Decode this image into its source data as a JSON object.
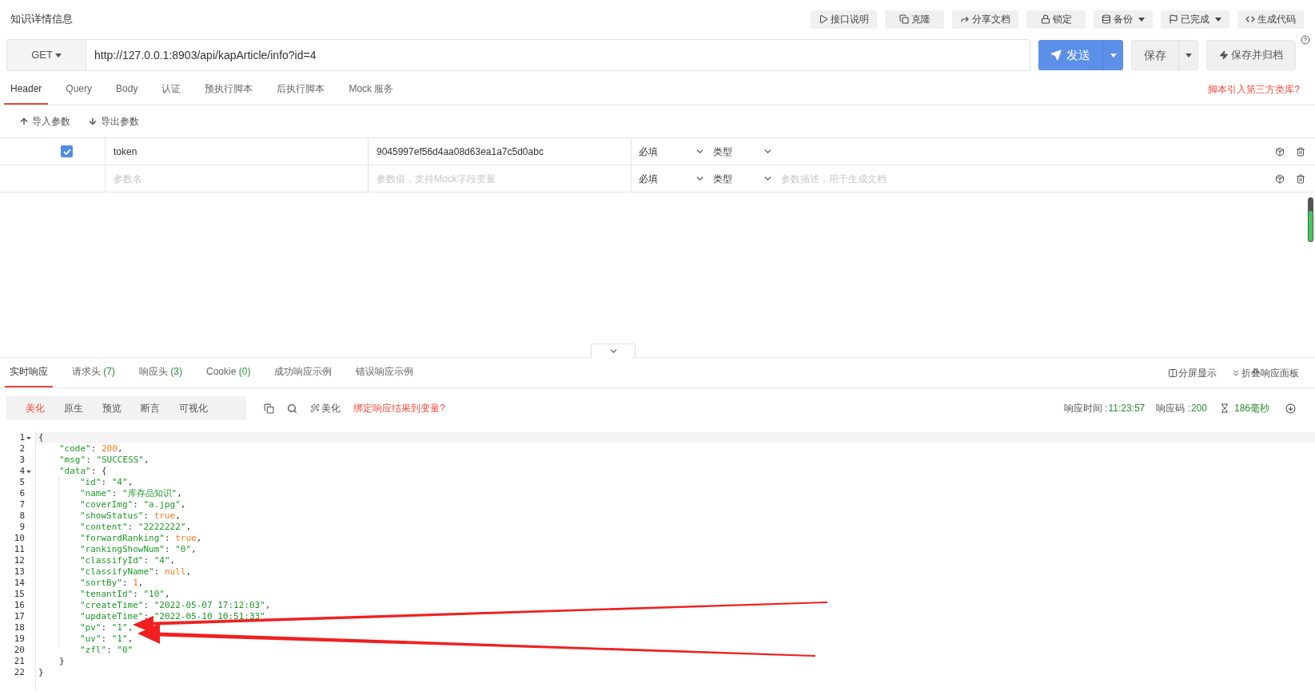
{
  "page_title": "知识详情信息",
  "toolbar": [
    {
      "label": "接口说明",
      "caret": false
    },
    {
      "label": "克隆",
      "caret": false
    },
    {
      "label": "分享文档",
      "caret": false
    },
    {
      "label": "锁定",
      "caret": false
    },
    {
      "label": "备份",
      "caret": true
    },
    {
      "label": "已完成",
      "caret": true
    },
    {
      "label": "生成代码",
      "caret": false
    }
  ],
  "request": {
    "method": "GET",
    "url": "http://127.0.0.1:8903/api/kapArticle/info?id=4",
    "send": "发送",
    "save": "保存",
    "save_archive": "保存并归档"
  },
  "request_tabs": [
    {
      "label": "Header",
      "selected": true
    },
    {
      "label": "Query",
      "selected": false
    },
    {
      "label": "Body",
      "selected": false
    },
    {
      "label": "认证",
      "selected": false
    },
    {
      "label": "预执行脚本",
      "selected": false
    },
    {
      "label": "后执行脚本",
      "selected": false
    },
    {
      "label": "Mock 服务",
      "selected": false
    }
  ],
  "script_link": "脚本引入第三方类库?",
  "param_actions": [
    "导入参数",
    "导出参数"
  ],
  "header_rows": [
    {
      "kind": "param",
      "checked": true,
      "name": "token",
      "value": "9045997ef56d4aa08d63ea1a7c5d0abc",
      "required": "必填",
      "type": "类型"
    },
    {
      "kind": "blank",
      "name_placeholder": "参数名",
      "value_placeholder": "参数值，支持Mock字段变量",
      "required": "必填",
      "type": "类型",
      "description_placeholder": "参数描述，用于生成文档"
    }
  ],
  "response_tabs": [
    {
      "label": "实时响应",
      "selected": true
    },
    {
      "label": "请求头",
      "count": "(7)",
      "selected": false
    },
    {
      "label": "响应头",
      "count": "(3)",
      "selected": false
    },
    {
      "label": "Cookie",
      "count": "(0)",
      "selected": false
    },
    {
      "label": "成功响应示例",
      "selected": false
    },
    {
      "label": "错误响应示例",
      "selected": false
    }
  ],
  "response_actions": [
    "分屏显示",
    "折叠响应面板"
  ],
  "view_modes": [
    {
      "label": "美化",
      "selected": true
    },
    {
      "label": "原生",
      "selected": false
    },
    {
      "label": "预览",
      "selected": false
    },
    {
      "label": "断言",
      "selected": false
    },
    {
      "label": "可视化",
      "selected": false
    }
  ],
  "beautify": "美化",
  "bind_link": "绑定响应结果到变量?",
  "status": {
    "time_label": "响应时间 : ",
    "time": "11:23:57",
    "code_label": "响应码 : ",
    "code": "200",
    "duration": "186毫秒"
  },
  "code_lines": [
    {
      "number": "1",
      "fold": true,
      "segments": [
        {
          "kind": "punct",
          "text": "{"
        }
      ],
      "children": [
        {
          "number": "2",
          "fold": false,
          "segments": [
            {
              "kind": "key",
              "text": "\"code\""
            },
            {
              "kind": "punct",
              "text": ": "
            },
            {
              "kind": "literal",
              "text": "200"
            },
            {
              "kind": "punct",
              "text": ","
            }
          ]
        },
        {
          "number": "3",
          "fold": false,
          "segments": [
            {
              "kind": "key",
              "text": "\"msg\""
            },
            {
              "kind": "punct",
              "text": ": "
            },
            {
              "kind": "string",
              "text": "\"SUCCESS\""
            },
            {
              "kind": "punct",
              "text": ","
            }
          ]
        },
        {
          "number": "4",
          "fold": true,
          "segments": [
            {
              "kind": "key",
              "text": "\"data\""
            },
            {
              "kind": "punct",
              "text": ": {"
            }
          ],
          "children": [
            {
              "number": "5",
              "fold": false,
              "segments": [
                {
                  "kind": "key",
                  "text": "\"id\""
                },
                {
                  "kind": "punct",
                  "text": ": "
                },
                {
                  "kind": "string",
                  "text": "\"4\""
                },
                {
                  "kind": "punct",
                  "text": ","
                }
              ]
            },
            {
              "number": "6",
              "fold": false,
              "segments": [
                {
                  "kind": "key",
                  "text": "\"name\""
                },
                {
                  "kind": "punct",
                  "text": ": "
                },
                {
                  "kind": "string",
                  "text": "\"库存品知识\""
                },
                {
                  "kind": "punct",
                  "text": ","
                }
              ]
            },
            {
              "number": "7",
              "fold": false,
              "segments": [
                {
                  "kind": "key",
                  "text": "\"coverImg\""
                },
                {
                  "kind": "punct",
                  "text": ": "
                },
                {
                  "kind": "string",
                  "text": "\"a.jpg\""
                },
                {
                  "kind": "punct",
                  "text": ","
                }
              ]
            },
            {
              "number": "8",
              "fold": false,
              "segments": [
                {
                  "kind": "key",
                  "text": "\"showStatus\""
                },
                {
                  "kind": "punct",
                  "text": ": "
                },
                {
                  "kind": "literal",
                  "text": "true"
                },
                {
                  "kind": "punct",
                  "text": ","
                }
              ]
            },
            {
              "number": "9",
              "fold": false,
              "segments": [
                {
                  "kind": "key",
                  "text": "\"content\""
                },
                {
                  "kind": "punct",
                  "text": ": "
                },
                {
                  "kind": "string",
                  "text": "\"2222222\""
                },
                {
                  "kind": "punct",
                  "text": ","
                }
              ]
            },
            {
              "number": "10",
              "fold": false,
              "segments": [
                {
                  "kind": "key",
                  "text": "\"forwardRanking\""
                },
                {
                  "kind": "punct",
                  "text": ": "
                },
                {
                  "kind": "literal",
                  "text": "true"
                },
                {
                  "kind": "punct",
                  "text": ","
                }
              ]
            },
            {
              "number": "11",
              "fold": false,
              "segments": [
                {
                  "kind": "key",
                  "text": "\"rankingShowNum\""
                },
                {
                  "kind": "punct",
                  "text": ": "
                },
                {
                  "kind": "string",
                  "text": "\"0\""
                },
                {
                  "kind": "punct",
                  "text": ","
                }
              ]
            },
            {
              "number": "12",
              "fold": false,
              "segments": [
                {
                  "kind": "key",
                  "text": "\"classifyId\""
                },
                {
                  "kind": "punct",
                  "text": ": "
                },
                {
                  "kind": "string",
                  "text": "\"4\""
                },
                {
                  "kind": "punct",
                  "text": ","
                }
              ]
            },
            {
              "number": "13",
              "fold": false,
              "segments": [
                {
                  "kind": "key",
                  "text": "\"classifyName\""
                },
                {
                  "kind": "punct",
                  "text": ": "
                },
                {
                  "kind": "literal",
                  "text": "null"
                },
                {
                  "kind": "punct",
                  "text": ","
                }
              ]
            },
            {
              "number": "14",
              "fold": false,
              "segments": [
                {
                  "kind": "key",
                  "text": "\"sortBy\""
                },
                {
                  "kind": "punct",
                  "text": ": "
                },
                {
                  "kind": "literal",
                  "text": "1"
                },
                {
                  "kind": "punct",
                  "text": ","
                }
              ]
            },
            {
              "number": "15",
              "fold": false,
              "segments": [
                {
                  "kind": "key",
                  "text": "\"tenantId\""
                },
                {
                  "kind": "punct",
                  "text": ": "
                },
                {
                  "kind": "string",
                  "text": "\"10\""
                },
                {
                  "kind": "punct",
                  "text": ","
                }
              ]
            },
            {
              "number": "16",
              "fold": false,
              "segments": [
                {
                  "kind": "key",
                  "text": "\"createTime\""
                },
                {
                  "kind": "punct",
                  "text": ": "
                },
                {
                  "kind": "string",
                  "text": "\"2022-05-07 17:12:03\""
                },
                {
                  "kind": "punct",
                  "text": ","
                }
              ]
            },
            {
              "number": "17",
              "fold": false,
              "segments": [
                {
                  "kind": "key",
                  "text": "\"updateTime\""
                },
                {
                  "kind": "punct",
                  "text": ": "
                },
                {
                  "kind": "string",
                  "text": "\"2022-05-10 10:51:33\""
                }
              ]
            },
            {
              "number": "18",
              "fold": false,
              "segments": [
                {
                  "kind": "key",
                  "text": "\"pv\""
                },
                {
                  "kind": "punct",
                  "text": ": "
                },
                {
                  "kind": "string",
                  "text": "\"1\""
                },
                {
                  "kind": "punct",
                  "text": ","
                }
              ]
            },
            {
              "number": "19",
              "fold": false,
              "segments": [
                {
                  "kind": "key",
                  "text": "\"uv\""
                },
                {
                  "kind": "punct",
                  "text": ": "
                },
                {
                  "kind": "string",
                  "text": "\"1\""
                },
                {
                  "kind": "punct",
                  "text": ","
                }
              ]
            },
            {
              "number": "20",
              "fold": false,
              "segments": [
                {
                  "kind": "key",
                  "text": "\"zfl\""
                },
                {
                  "kind": "punct",
                  "text": ": "
                },
                {
                  "kind": "string",
                  "text": "\"0\""
                }
              ]
            }
          ]
        },
        {
          "number": "21",
          "fold": false,
          "segments": [
            {
              "kind": "punct",
              "text": "}"
            }
          ]
        }
      ]
    },
    {
      "number": "22",
      "fold": false,
      "segments": [
        {
          "kind": "punct",
          "text": "}"
        }
      ]
    }
  ]
}
